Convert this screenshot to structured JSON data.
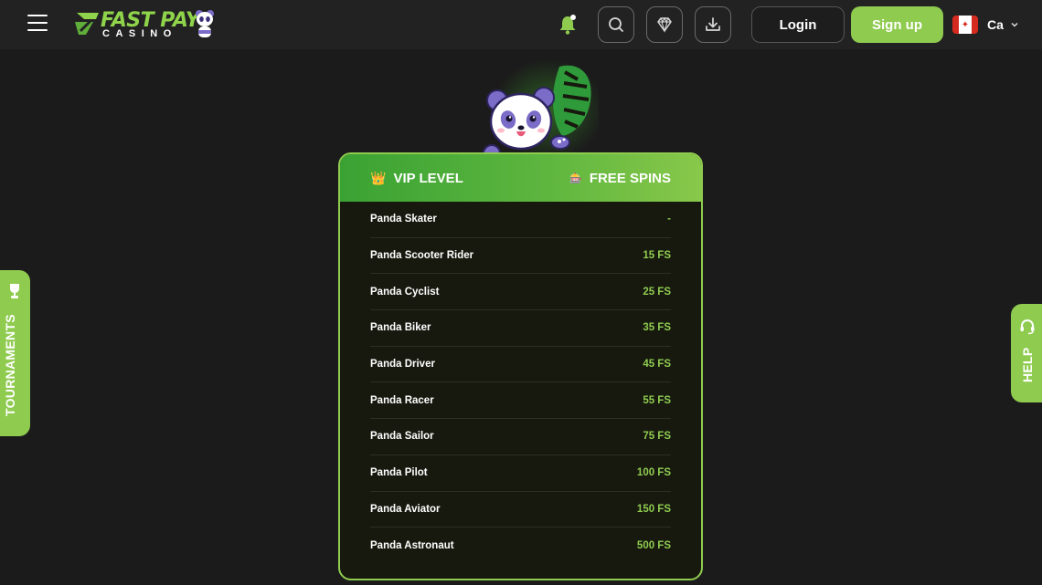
{
  "header": {
    "logo_top": "FAST PAY",
    "logo_bottom": "CASINO",
    "login_label": "Login",
    "signup_label": "Sign up",
    "language": "Ca"
  },
  "side": {
    "tournaments_label": "TOURNAMENTS",
    "help_label": "HELP"
  },
  "vip_table": {
    "col_level": "VIP LEVEL",
    "col_spins": "FREE SPINS",
    "rows": [
      {
        "name": "Panda Skater",
        "value": "-"
      },
      {
        "name": "Panda Scooter Rider",
        "value": "15 FS"
      },
      {
        "name": "Panda Cyclist",
        "value": "25 FS"
      },
      {
        "name": "Panda Biker",
        "value": "35 FS"
      },
      {
        "name": "Panda Driver",
        "value": "45 FS"
      },
      {
        "name": "Panda Racer",
        "value": "55 FS"
      },
      {
        "name": "Panda Sailor",
        "value": "75 FS"
      },
      {
        "name": "Panda Pilot",
        "value": "100 FS"
      },
      {
        "name": "Panda Aviator",
        "value": "150 FS"
      },
      {
        "name": "Panda Astronaut",
        "value": "500 FS"
      }
    ]
  },
  "colors": {
    "accent": "#8fcb4f",
    "background": "#1b1b1b",
    "header": "#222222"
  },
  "icons": [
    "menu-icon",
    "bell-icon",
    "search-icon",
    "diamond-icon",
    "download-icon",
    "chevron-down-icon",
    "trophy-icon",
    "headset-icon",
    "crown-icon",
    "gift-icon"
  ]
}
